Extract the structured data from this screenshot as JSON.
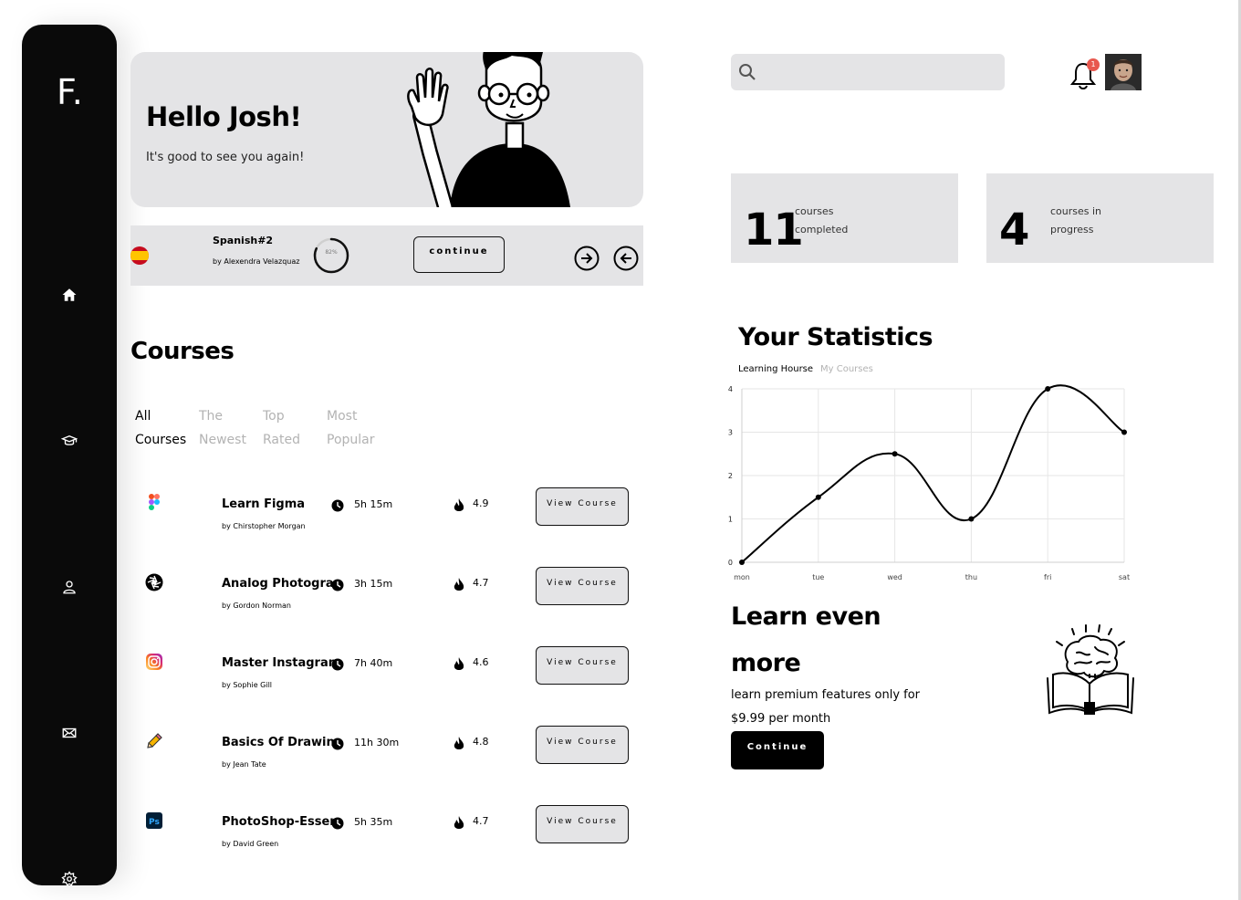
{
  "sidebar": {
    "logo": "F.",
    "items": [
      {
        "icon": "home-icon"
      },
      {
        "icon": "graduation-cap-icon"
      },
      {
        "icon": "user-icon"
      },
      {
        "icon": "mail-icon"
      },
      {
        "icon": "settings-icon"
      }
    ]
  },
  "hero": {
    "title": "Hello Josh!",
    "subtitle": "It's good to see you again!"
  },
  "continue_card": {
    "flag_icon": "spain-flag-icon",
    "course": "Spanish#2",
    "author": "by Alexendra Velazquaz",
    "progress": 82,
    "progress_label": "82%",
    "button": "continue",
    "next_icon": "arrow-right-circle-icon",
    "prev_icon": "arrow-left-circle-icon"
  },
  "courses": {
    "title": "Courses",
    "tabs": [
      {
        "line1": "All",
        "line2": "Courses",
        "active": true
      },
      {
        "line1": "The",
        "line2": "Newest",
        "active": false
      },
      {
        "line1": "Top",
        "line2": "Rated",
        "active": false
      },
      {
        "line1": "Most",
        "line2": "Popular",
        "active": false
      }
    ],
    "items": [
      {
        "name": "Learn Figma",
        "author": "by Chirstopher Morgan",
        "duration": "5h 15m",
        "rating": "4.9",
        "button": "View Course",
        "icon": "figma-icon"
      },
      {
        "name": "Analog Photography",
        "author": "by Gordon Norman",
        "duration": "3h 15m",
        "rating": "4.7",
        "button": "View Course",
        "icon": "camera-aperture-icon"
      },
      {
        "name": "Master Instagram",
        "author": "by Sophie Gill",
        "duration": "7h 40m",
        "rating": "4.6",
        "button": "View Course",
        "icon": "instagram-icon"
      },
      {
        "name": "Basics Of Drawing",
        "author": "by Jean Tate",
        "duration": "11h 30m",
        "rating": "4.8",
        "button": "View Course",
        "icon": "pencil-icon"
      },
      {
        "name": "PhotoShop-Essence",
        "author": "by David Green",
        "duration": "5h 35m",
        "rating": "4.7",
        "button": "View Course",
        "icon": "photoshop-icon"
      }
    ]
  },
  "header": {
    "search_placeholder": "",
    "notification_count": "1"
  },
  "stats_cards": [
    {
      "value": "11",
      "line1": "courses",
      "line2": "completed"
    },
    {
      "value": "4",
      "line1": "courses in",
      "line2": "progress"
    }
  ],
  "statistics": {
    "title": "Your Statistics",
    "tab_active": "Learning Hourse",
    "tab_inactive": "My Courses"
  },
  "chart_data": {
    "type": "line",
    "title": "",
    "categories": [
      "mon",
      "tue",
      "wed",
      "thu",
      "fri",
      "sat"
    ],
    "values": [
      0,
      1.5,
      2.5,
      1,
      4,
      3
    ],
    "ylim": [
      0,
      4
    ],
    "yticks": [
      0,
      1,
      2,
      3,
      4
    ],
    "grid": true,
    "line_color": "#000000",
    "grid_color": "#e6e6e6"
  },
  "promo": {
    "title": "Learn even more",
    "text": "learn premium features only for $9.99 per month",
    "button": "Continue"
  },
  "colors": {
    "panel": "#e4e4e6",
    "sidebar": "#0a0a0a",
    "badge": "#e8584f"
  }
}
